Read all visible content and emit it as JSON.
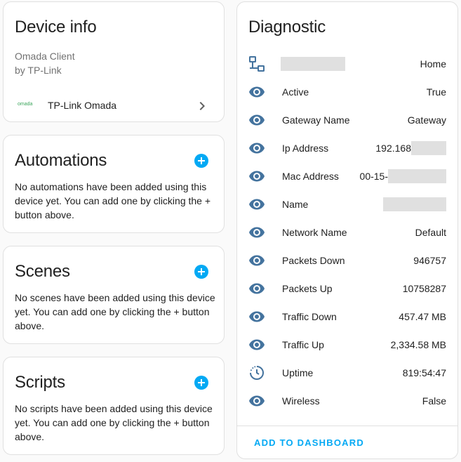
{
  "device_info": {
    "title": "Device info",
    "model": "Omada Client",
    "manufacturer": "by TP-Link",
    "integration_logo_text": "omada",
    "integration_name": "TP-Link Omada"
  },
  "automations": {
    "title": "Automations",
    "empty_text": "No automations have been added using this device yet. You can add one by clicking the + button above."
  },
  "scenes": {
    "title": "Scenes",
    "empty_text": "No scenes have been added using this device yet. You can add one by clicking the + button above."
  },
  "scripts": {
    "title": "Scripts",
    "empty_text": "No scripts have been added using this device yet. You can add one by clicking the + button above."
  },
  "diagnostic": {
    "title": "Diagnostic",
    "rows": [
      {
        "label": "",
        "value": "Home",
        "icon": "lan-icon"
      },
      {
        "label": "Active",
        "value": "True",
        "icon": "eye-icon"
      },
      {
        "label": "Gateway Name",
        "value": "Gateway",
        "icon": "eye-icon"
      },
      {
        "label": "Ip Address",
        "value": "192.168",
        "icon": "eye-icon"
      },
      {
        "label": "Mac Address",
        "value": "00-15-",
        "icon": "eye-icon"
      },
      {
        "label": "Name",
        "value": "",
        "icon": "eye-icon"
      },
      {
        "label": "Network Name",
        "value": "Default",
        "icon": "eye-icon"
      },
      {
        "label": "Packets Down",
        "value": "946757",
        "icon": "eye-icon"
      },
      {
        "label": "Packets Up",
        "value": "10758287",
        "icon": "eye-icon"
      },
      {
        "label": "Traffic Down",
        "value": "457.47 MB",
        "icon": "eye-icon"
      },
      {
        "label": "Traffic Up",
        "value": "2,334.58 MB",
        "icon": "eye-icon"
      },
      {
        "label": "Uptime",
        "value": "819:54:47",
        "icon": "timer-icon"
      },
      {
        "label": "Wireless",
        "value": "False",
        "icon": "eye-icon"
      }
    ],
    "add_to_dashboard": "ADD TO DASHBOARD"
  },
  "colors": {
    "accent": "#03a9f4",
    "icon": "#44739e",
    "redaction": "#e0e0e0",
    "divider": "#e0e0e0"
  }
}
